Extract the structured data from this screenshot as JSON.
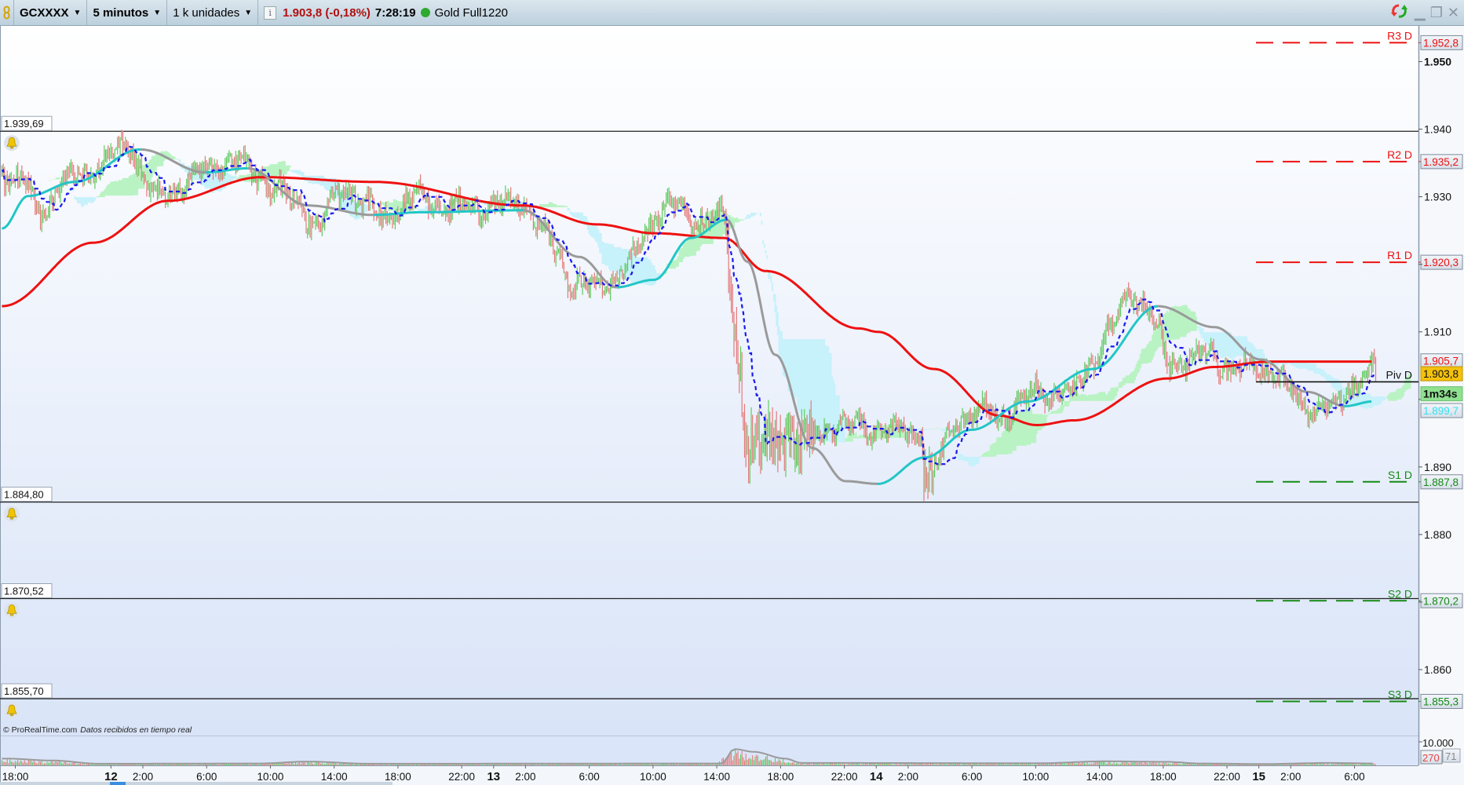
{
  "toolbar": {
    "symbol": "GCXXXX",
    "timeframe": "5 minutos",
    "units": "1 k unidades",
    "price_change": "1.903,8 (-0,18%)",
    "time": "7:28:19",
    "status_color": "#2eaa2e",
    "feed": "Gold Full1220",
    "icons": [
      "link-icon",
      "info-icon",
      "refresh-icon",
      "minimize-icon",
      "restore-icon",
      "close-icon"
    ]
  },
  "footer": {
    "copyright": "© ProRealTime.com",
    "status": "Datos recibidos en tiempo real"
  },
  "colors": {
    "candle_up": "#5fcc5f",
    "candle_down": "#e57a7a",
    "slow_ma": "#ee1111",
    "ma_rising": "#22c6c6",
    "ma_falling": "#9a9a9a",
    "tenkan": "#1818ee",
    "cloud_bull": "#b9f3c3",
    "cloud_bear": "#c7f1fb",
    "resistance": "#ee1111",
    "support": "#168a16"
  },
  "chart_data": {
    "type": "candlestick",
    "instrument": "GCXXXX",
    "interval": "5 minutos",
    "x_unit": "hours since day 11 18:00",
    "x_range": [
      -0.84,
      85.3
    ],
    "y_range": [
      1850.2,
      1955.3
    ],
    "close_path": [
      [
        -0.84,
        1933.6
      ],
      [
        0.8,
        1931.5
      ],
      [
        1.38,
        1927.3
      ],
      [
        3.14,
        1932.2
      ],
      [
        4.9,
        1934.2
      ],
      [
        7.24,
        1937.7
      ],
      [
        8.71,
        1929.4
      ],
      [
        10.76,
        1932.2
      ],
      [
        13.69,
        1935.6
      ],
      [
        16.61,
        1930.8
      ],
      [
        18.96,
        1926
      ],
      [
        20.71,
        1931.5
      ],
      [
        23.06,
        1926.6
      ],
      [
        24.81,
        1930.1
      ],
      [
        28.33,
        1928
      ],
      [
        31.85,
        1929.4
      ],
      [
        33.02,
        1925.3
      ],
      [
        34.78,
        1917.7
      ],
      [
        36.53,
        1916.3
      ],
      [
        38.88,
        1921.1
      ],
      [
        40.63,
        1929.4
      ],
      [
        42.39,
        1926.6
      ],
      [
        44.44,
        1927.3
      ],
      [
        45.03,
        1912.1
      ],
      [
        45.91,
        1894.2
      ],
      [
        46.79,
        1892.8
      ],
      [
        47.67,
        1894.9
      ],
      [
        49.42,
        1894.2
      ],
      [
        51.77,
        1896.2
      ],
      [
        54.7,
        1895.5
      ],
      [
        56.75,
        1894.9
      ],
      [
        57.21,
        1887.3
      ],
      [
        57.92,
        1891.4
      ],
      [
        59.38,
        1898.3
      ],
      [
        61.72,
        1897.6
      ],
      [
        64.07,
        1901.1
      ],
      [
        66.41,
        1901.1
      ],
      [
        68.17,
        1908
      ],
      [
        69.93,
        1916.3
      ],
      [
        71.1,
        1913.5
      ],
      [
        72.27,
        1905.2
      ],
      [
        74.61,
        1906.6
      ],
      [
        76.37,
        1904.5
      ],
      [
        78.71,
        1904.5
      ],
      [
        81.06,
        1898.3
      ],
      [
        82.82,
        1899
      ],
      [
        84.57,
        1903.8
      ],
      [
        85.15,
        1904.1
      ]
    ],
    "slow_ma": [
      [
        -0.84,
        1913.8
      ],
      [
        4.9,
        1923.2
      ],
      [
        9.58,
        1929.4
      ],
      [
        15.44,
        1932.9
      ],
      [
        22.47,
        1932.2
      ],
      [
        31.85,
        1928.7
      ],
      [
        36.53,
        1925.9
      ],
      [
        40.05,
        1924.6
      ],
      [
        44.44,
        1923.9
      ],
      [
        47.08,
        1919
      ],
      [
        52.94,
        1910.5
      ],
      [
        54.11,
        1910
      ],
      [
        57.62,
        1904.5
      ],
      [
        61.72,
        1897.6
      ],
      [
        64.07,
        1896.2
      ],
      [
        66.41,
        1896.9
      ],
      [
        72.27,
        1903.1
      ],
      [
        75.2,
        1904.8
      ],
      [
        78.71,
        1905.6
      ],
      [
        85.15,
        1905.6
      ]
    ],
    "fast_ma": [
      [
        -0.84,
        1925.3
      ],
      [
        0.8,
        1930.1
      ],
      [
        3.73,
        1932.2
      ],
      [
        7.83,
        1937
      ],
      [
        11.93,
        1933.6
      ],
      [
        14.56,
        1934.2
      ],
      [
        18.37,
        1928.7
      ],
      [
        22.47,
        1927.3
      ],
      [
        25.4,
        1927.7
      ],
      [
        31.85,
        1928
      ],
      [
        35.36,
        1921.1
      ],
      [
        37.7,
        1916.6
      ],
      [
        40.05,
        1917.7
      ],
      [
        42.39,
        1923.9
      ],
      [
        44.62,
        1926.6
      ],
      [
        45.91,
        1920.4
      ],
      [
        47.67,
        1906.6
      ],
      [
        50.01,
        1892.8
      ],
      [
        52.06,
        1887.9
      ],
      [
        54.11,
        1887.5
      ],
      [
        57.04,
        1891.4
      ],
      [
        59.97,
        1895.5
      ],
      [
        63.48,
        1899.7
      ],
      [
        67.58,
        1904.5
      ],
      [
        71.68,
        1913.8
      ],
      [
        75.2,
        1910.7
      ],
      [
        78.13,
        1905.9
      ],
      [
        81.06,
        1901.1
      ],
      [
        83.4,
        1899
      ],
      [
        85.15,
        1899.7
      ]
    ],
    "volume_path": [
      [
        -0.84,
        2500
      ],
      [
        2,
        1800
      ],
      [
        5,
        600
      ],
      [
        15,
        700
      ],
      [
        18,
        1400
      ],
      [
        22,
        600
      ],
      [
        44,
        700
      ],
      [
        44.8,
        6000
      ],
      [
        46,
        5000
      ],
      [
        48,
        2500
      ],
      [
        49,
        900
      ],
      [
        64,
        800
      ],
      [
        68,
        1500
      ],
      [
        72,
        1300
      ],
      [
        74,
        700
      ],
      [
        78,
        500
      ],
      [
        82,
        900
      ],
      [
        85.3,
        700
      ]
    ],
    "price_ticks": [
      {
        "value": 1950,
        "label": "1.950",
        "bold": true
      },
      {
        "value": 1940,
        "label": "1.940"
      },
      {
        "value": 1930,
        "label": "1.930"
      },
      {
        "value": 1920,
        "label": ""
      },
      {
        "value": 1910,
        "label": "1.910"
      },
      {
        "value": 1900,
        "label": ""
      },
      {
        "value": 1890,
        "label": "1.890"
      },
      {
        "value": 1880,
        "label": "1.880"
      },
      {
        "value": 1870,
        "label": ""
      },
      {
        "value": 1860,
        "label": "1.860"
      }
    ],
    "pivots": [
      {
        "name": "R3 D",
        "value": 1952.8,
        "label": "1.952,8",
        "kind": "resistance"
      },
      {
        "name": "R2 D",
        "value": 1935.2,
        "label": "1.935,2",
        "kind": "resistance"
      },
      {
        "name": "R1 D",
        "value": 1920.3,
        "label": "1.920,3",
        "kind": "resistance"
      },
      {
        "name": "Piv D",
        "value": 1902.6,
        "label": "",
        "kind": "pivot"
      },
      {
        "name": "S1 D",
        "value": 1887.8,
        "label": "1.887,8",
        "kind": "support"
      },
      {
        "name": "S2 D",
        "value": 1870.2,
        "label": "1.870,2",
        "kind": "support"
      },
      {
        "name": "S3 D",
        "value": 1855.3,
        "label": "1.855,3",
        "kind": "support"
      }
    ],
    "price_markers": [
      {
        "value": 1905.7,
        "label": "1.905,7",
        "style": "ma"
      },
      {
        "value": 1903.8,
        "label": "1.903,8",
        "style": "last"
      },
      {
        "value": 1901.3,
        "label": "1m34s",
        "style": "countdown"
      },
      {
        "value": 1898.7,
        "label": "1.899,7",
        "style": "cyan"
      }
    ],
    "alert_lines": [
      {
        "value": 1939.69,
        "label": "1.939,69"
      },
      {
        "value": 1884.8,
        "label": "1.884,80"
      },
      {
        "value": 1870.52,
        "label": "1.870,52"
      },
      {
        "value": 1855.7,
        "label": "1.855,70"
      }
    ],
    "volume_axis": {
      "label": "10.000",
      "marker_red": "270",
      "marker_gray": "71"
    },
    "time_labels": [
      {
        "h": 0,
        "label": "18:00"
      },
      {
        "h": 6,
        "label": "12",
        "day": true
      },
      {
        "h": 8,
        "label": "2:00"
      },
      {
        "h": 12,
        "label": "6:00"
      },
      {
        "h": 16,
        "label": "10:00"
      },
      {
        "h": 20,
        "label": "14:00"
      },
      {
        "h": 24,
        "label": "18:00"
      },
      {
        "h": 28,
        "label": "22:00"
      },
      {
        "h": 30,
        "label": "13",
        "day": true
      },
      {
        "h": 32,
        "label": "2:00"
      },
      {
        "h": 36,
        "label": "6:00"
      },
      {
        "h": 40,
        "label": "10:00"
      },
      {
        "h": 44,
        "label": "14:00"
      },
      {
        "h": 48,
        "label": "18:00"
      },
      {
        "h": 52,
        "label": "22:00"
      },
      {
        "h": 54,
        "label": "14",
        "day": true
      },
      {
        "h": 56,
        "label": "2:00"
      },
      {
        "h": 60,
        "label": "6:00"
      },
      {
        "h": 64,
        "label": "10:00"
      },
      {
        "h": 68,
        "label": "14:00"
      },
      {
        "h": 72,
        "label": "18:00"
      },
      {
        "h": 76,
        "label": "22:00"
      },
      {
        "h": 78,
        "label": "15",
        "day": true
      },
      {
        "h": 80,
        "label": "2:00"
      },
      {
        "h": 84,
        "label": "6:00"
      }
    ]
  }
}
